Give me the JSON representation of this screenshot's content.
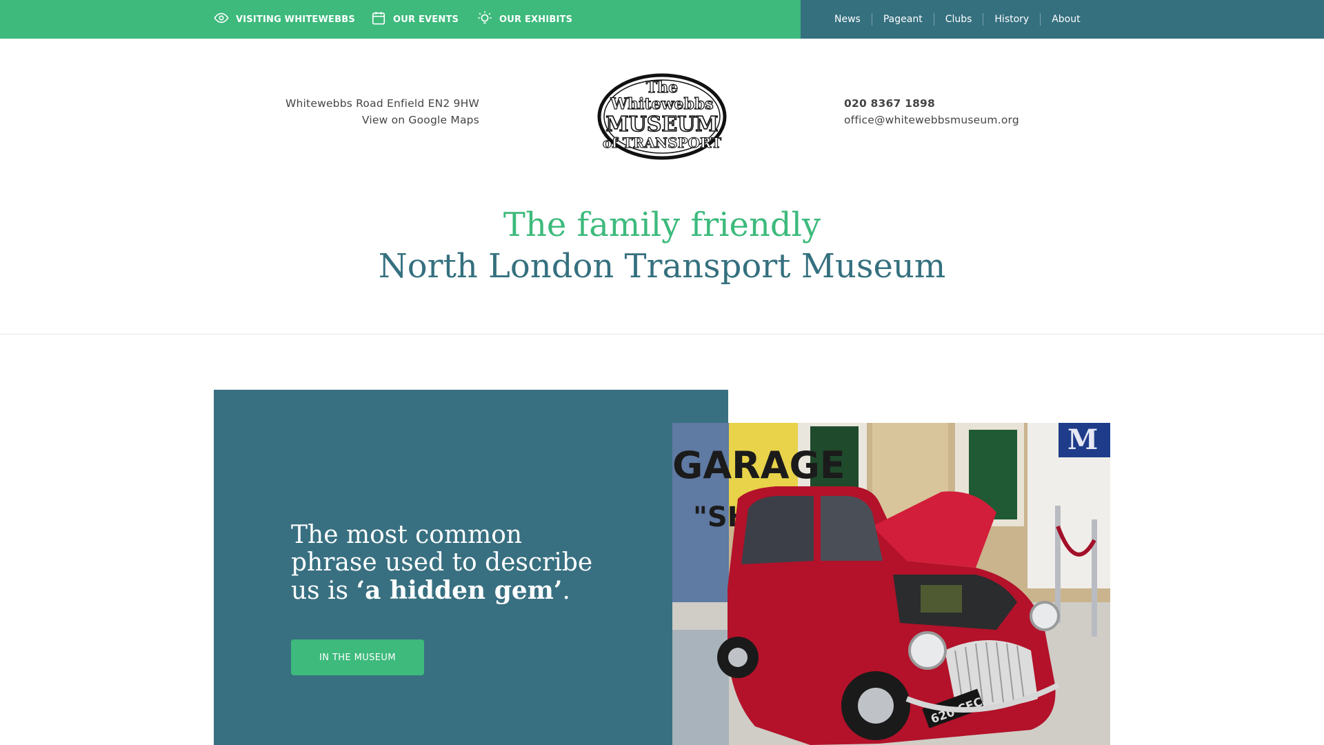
{
  "topbar": {
    "left_items": [
      {
        "label": "VISITING WHITEWEBBS",
        "icon": "eye-icon"
      },
      {
        "label": "OUR EVENTS",
        "icon": "calendar-icon"
      },
      {
        "label": "OUR EXHIBITS",
        "icon": "lightbulb-icon"
      }
    ],
    "sec_nav": [
      "News",
      "Pageant",
      "Clubs",
      "History",
      "About"
    ]
  },
  "header": {
    "address": "Whitewebbs Road Enfield EN2 9HW",
    "maps_link": "View on Google Maps",
    "phone": "020 8367 1898",
    "email": "office@whitewebbsmuseum.org",
    "logo": {
      "line1": "The",
      "line2": "Whitewebbs",
      "line3": "MUSEUM",
      "line4": "of TRANSPORT"
    }
  },
  "tagline": {
    "line1": "The family friendly",
    "line2": "North London Transport Museum"
  },
  "hero": {
    "text_before": "The most common phrase used to describe us is ",
    "text_bold": "‘a hidden gem’",
    "text_after": ".",
    "button_label": "IN THE MUSEUM",
    "photo_sign_text": "GARAGE",
    "photo_sign_text2": "\"SHELL\"",
    "photo_plate": "620 CFC"
  },
  "colors": {
    "green": "#3dba7c",
    "teal": "#35707f",
    "panel": "#387081",
    "car_red": "#b3122a"
  }
}
